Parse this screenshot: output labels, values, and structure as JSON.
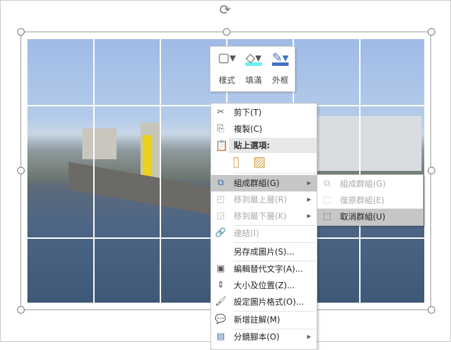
{
  "mini_toolbar": {
    "style": "樣式",
    "fill": "填滿",
    "outline": "外框",
    "fill_color": "#66f0f0",
    "outline_color": "#4472c4"
  },
  "menu": {
    "cut": "剪下(T)",
    "copy": "複製(C)",
    "paste_options": "貼上選項:",
    "group": "組成群組(G)",
    "bring_front": "移到最上層(R)",
    "send_back": "移到最下層(K)",
    "link": "連結(I)",
    "save_as_picture": "另存成圖片(S)...",
    "edit_alt_text": "編輯替代文字(A)...",
    "size_position": "大小及位置(Z)...",
    "format_picture": "設定圖片格式(O)...",
    "new_comment": "新增註解(M)",
    "storyboard": "分鏡腳本(O)"
  },
  "submenu": {
    "group": "組成群組(G)",
    "regroup": "復原群組(E)",
    "ungroup": "取消群組(U)"
  }
}
